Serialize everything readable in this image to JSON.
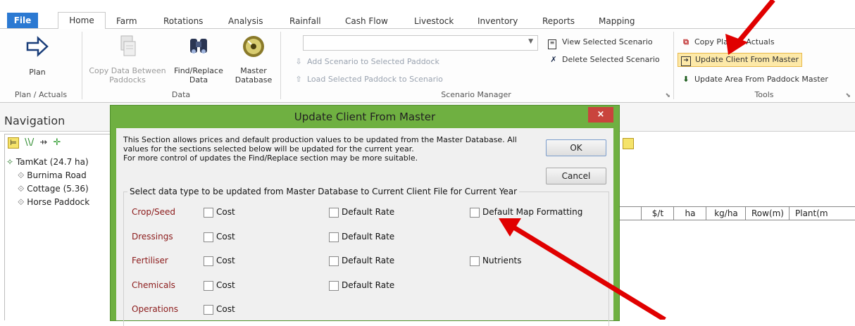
{
  "tabs": [
    "File",
    "Home",
    "Farm",
    "Rotations",
    "Analysis",
    "Rainfall",
    "Cash Flow",
    "Livestock",
    "Inventory",
    "Reports",
    "Mapping"
  ],
  "ribbon": {
    "plan": {
      "label": "Plan",
      "group": "Plan / Actuals"
    },
    "data": {
      "copy": [
        "Copy Data Between",
        "Paddocks"
      ],
      "find": [
        "Find/Replace",
        "Data"
      ],
      "master": [
        "Master",
        "Database"
      ],
      "group": "Data"
    },
    "scenario": {
      "add": "Add Scenario to Selected Paddock",
      "load": "Load Selected Paddock to Scenario",
      "view": "View Selected Scenario",
      "delete": "Delete Selected Scenario",
      "group": "Scenario Manager"
    },
    "tools": {
      "copy_plan": "Copy Plan To Actuals",
      "update_client": "Update Client From Master",
      "update_area": "Update Area From Paddock Master",
      "group": "Tools"
    }
  },
  "navigation": {
    "title": "Navigation",
    "items": [
      "TamKat (24.7 ha)",
      "Burnima Road",
      "Cottage  (5.36)",
      "Horse Paddock"
    ]
  },
  "grid_headers": [
    "$/t",
    "ha",
    "kg/ha",
    "Row(m)",
    "Plant(m"
  ],
  "dialog": {
    "title": "Update Client From Master",
    "close": "×",
    "description": [
      "This Section allows prices and default production values to be updated from the Master Database. All",
      "values for the sections selected below will be updated for the current year.",
      "For more control of updates the Find/Replace section may be more suitable."
    ],
    "ok": "OK",
    "cancel": "Cancel",
    "group_label": "Select data type to be updated from Master Database to Current Client File for Current Year",
    "rows": [
      {
        "label": "Crop/Seed",
        "c1": "Cost",
        "c2": "Default Rate",
        "c3": "Default Map Formatting"
      },
      {
        "label": "Dressings",
        "c1": "Cost",
        "c2": "Default Rate",
        "c3": ""
      },
      {
        "label": "Fertiliser",
        "c1": "Cost",
        "c2": "Default Rate",
        "c3": "Nutrients"
      },
      {
        "label": "Chemicals",
        "c1": "Cost",
        "c2": "Default Rate",
        "c3": ""
      },
      {
        "label": "Operations",
        "c1": "Cost",
        "c2": "",
        "c3": ""
      }
    ]
  },
  "colors": {
    "file_tab": "#2b79d2",
    "dialog_frame": "#6fb041",
    "row_label": "#8b1a1a",
    "arrow": "#e00000",
    "highlight": "#fde9a8"
  }
}
